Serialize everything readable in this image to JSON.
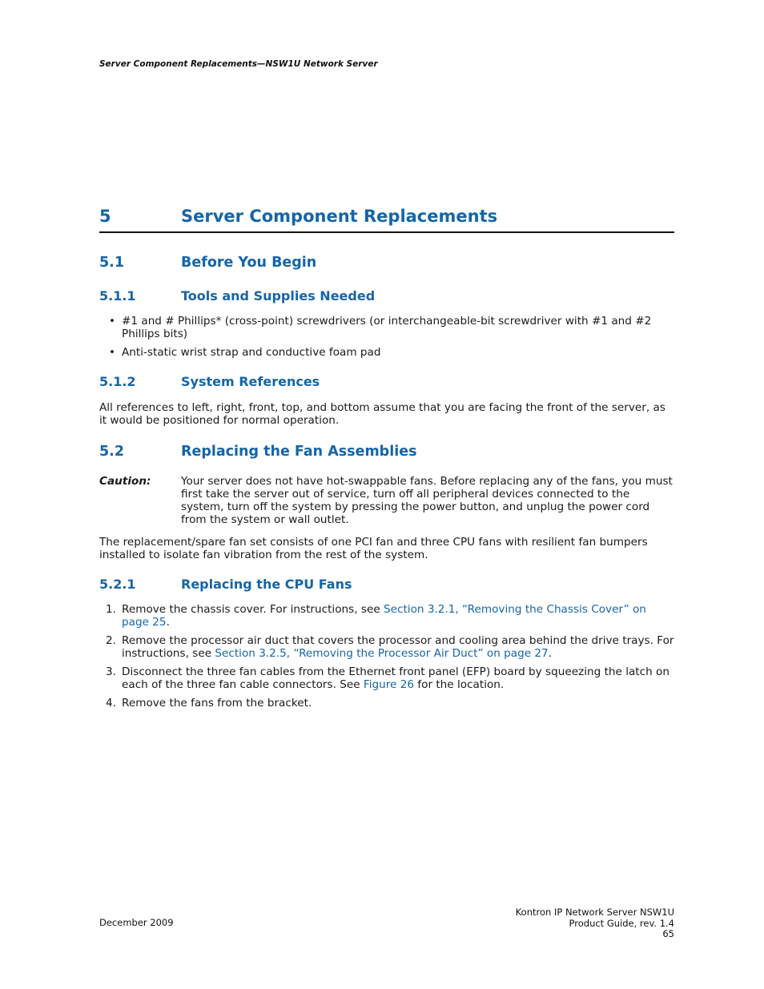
{
  "running_header": "Server Component Replacements—NSW1U Network Server",
  "chapter": {
    "number": "5",
    "title": "Server Component Replacements"
  },
  "sections": {
    "s5_1": {
      "number": "5.1",
      "title": "Before You Begin"
    },
    "s5_1_1": {
      "number": "5.1.1",
      "title": "Tools and Supplies Needed",
      "bullets": [
        "#1 and # Phillips* (cross-point) screwdrivers (or interchangeable-bit screwdriver with #1 and #2 Phillips bits)",
        "Anti-static wrist strap and conductive foam pad"
      ]
    },
    "s5_1_2": {
      "number": "5.1.2",
      "title": "System References",
      "paragraph": "All references to left, right, front, top, and bottom assume that you are facing the front of the server, as it would be positioned for normal operation."
    },
    "s5_2": {
      "number": "5.2",
      "title": "Replacing the Fan Assemblies",
      "caution_label": "Caution:",
      "caution_text": "Your server does not have hot-swappable fans. Before replacing any of the fans, you must first take the server out of service, turn off all peripheral devices connected to the system, turn off the system by pressing the power button, and unplug the power cord from the system or wall outlet.",
      "paragraph": "The replacement/spare fan set consists of one PCI fan and three CPU fans with resilient fan bumpers installed to isolate fan vibration from the rest of the system."
    },
    "s5_2_1": {
      "number": "5.2.1",
      "title": "Replacing the CPU Fans",
      "steps": [
        {
          "num": "1.",
          "before": "Remove the chassis cover. For instructions, see ",
          "link": "Section 3.2.1, “Removing the Chassis Cover” on page 25",
          "after": "."
        },
        {
          "num": "2.",
          "before": "Remove the processor air duct that covers the processor and cooling area behind the drive trays. For instructions, see ",
          "link": "Section 3.2.5, “Removing the Processor Air Duct” on page 27",
          "after": "."
        },
        {
          "num": "3.",
          "before": "Disconnect the three fan cables from the Ethernet front panel (EFP) board by squeezing the latch on each of the three fan cable connectors. See ",
          "link": "Figure 26",
          "after": " for the location."
        },
        {
          "num": "4.",
          "before": "Remove the fans from the bracket.",
          "link": null,
          "after": ""
        }
      ]
    }
  },
  "footer": {
    "date": "December 2009",
    "product": "Kontron IP Network Server NSW1U",
    "guide": "Product Guide, rev. 1.4",
    "page": "65"
  },
  "colors": {
    "heading": "#1565a8",
    "link": "#1565a8",
    "text": "#1a1a1a"
  }
}
